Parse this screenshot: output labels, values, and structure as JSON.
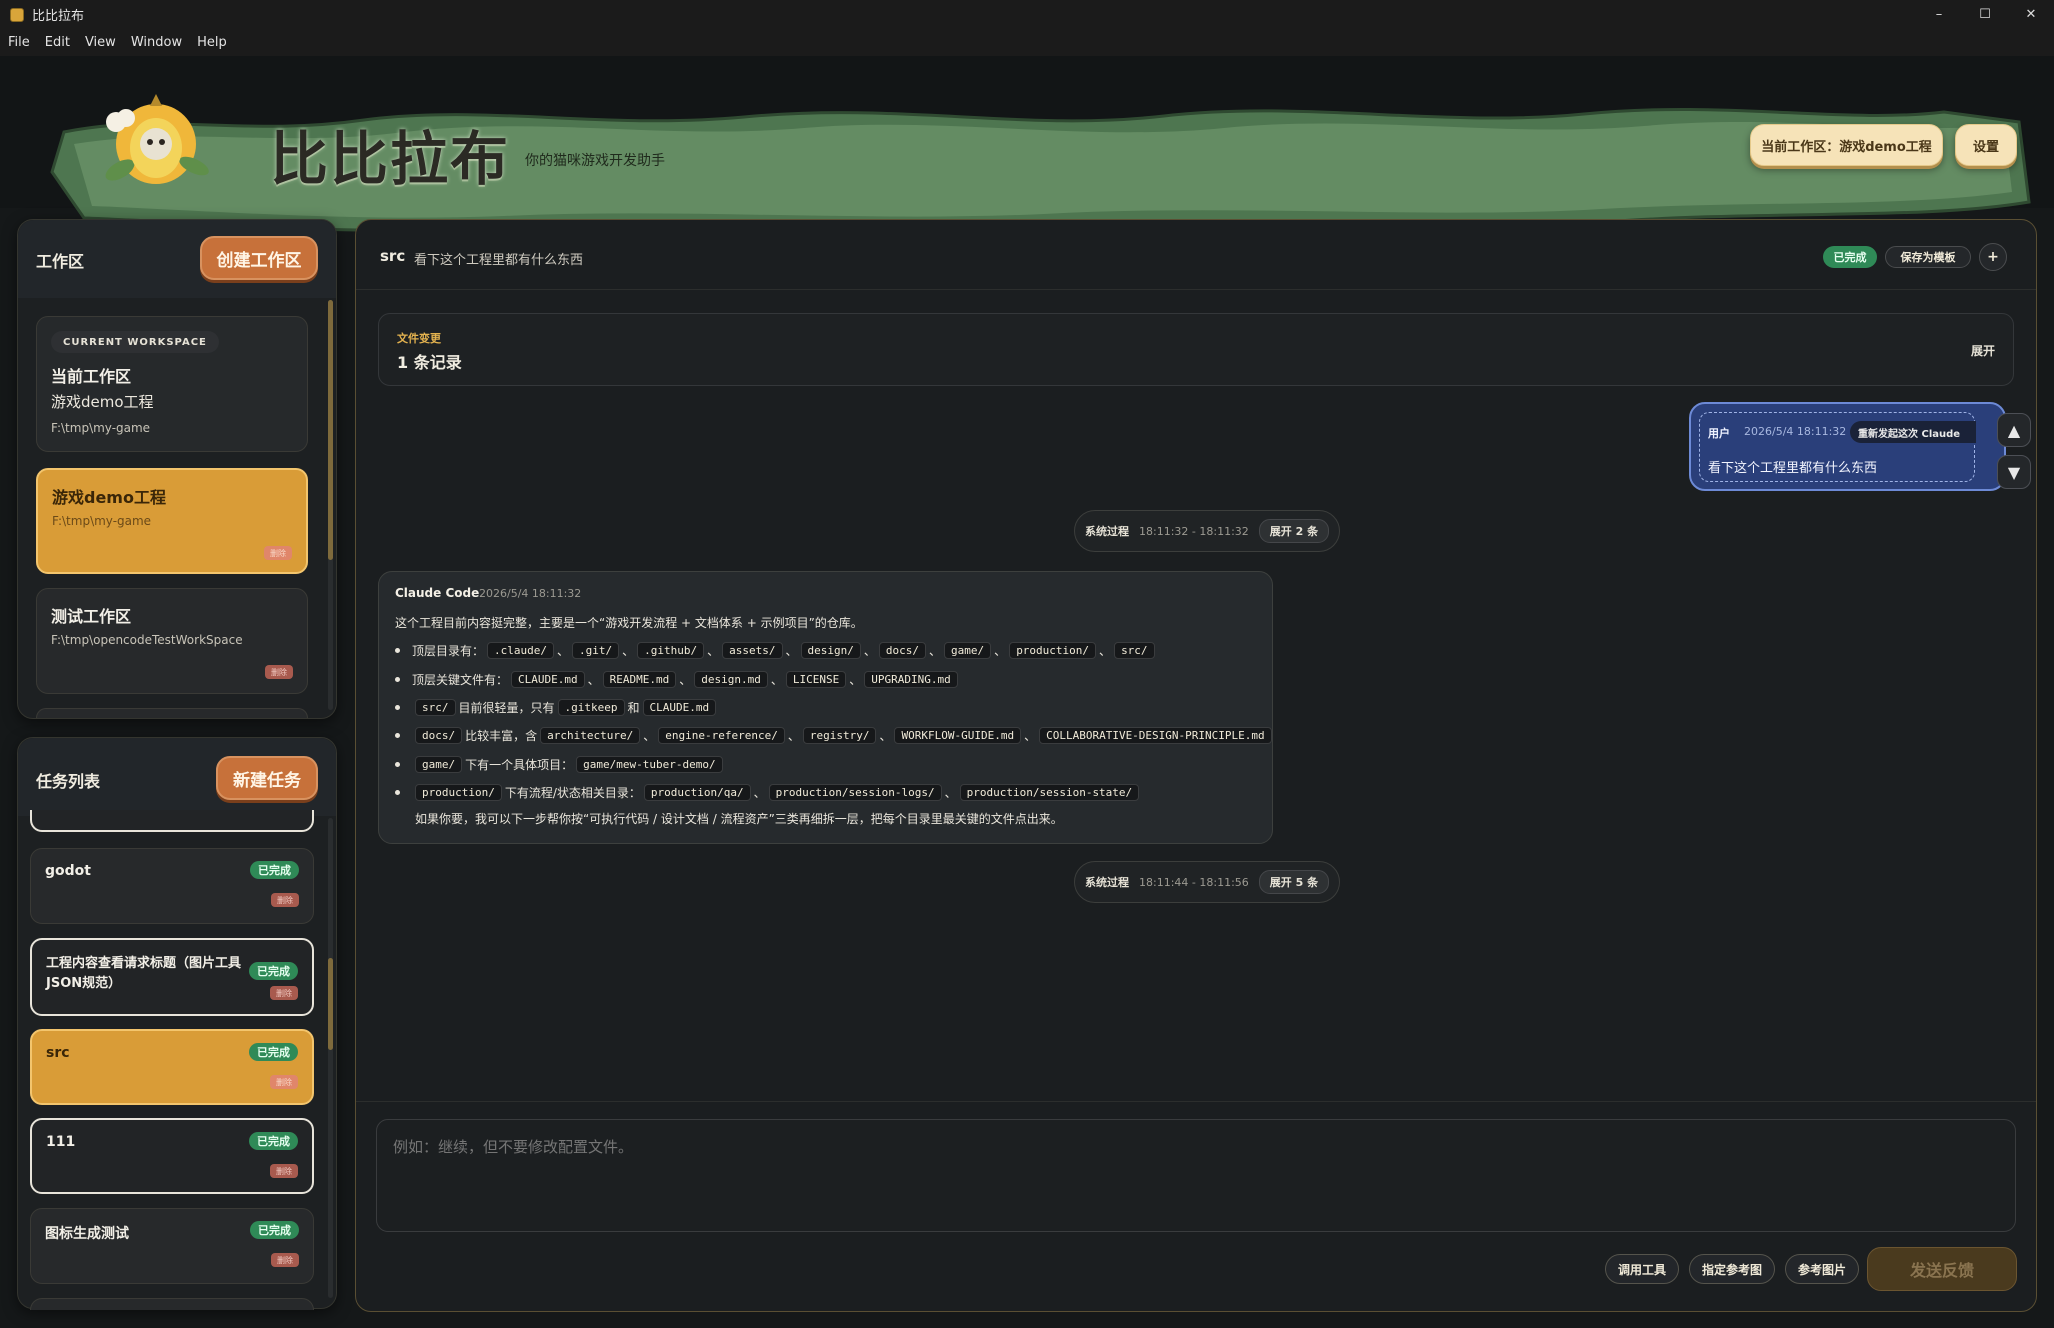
{
  "window": {
    "title": "比比拉布",
    "minimize": "–",
    "maximize": "☐",
    "close": "✕"
  },
  "menu": [
    "File",
    "Edit",
    "View",
    "Window",
    "Help"
  ],
  "header": {
    "brand": "比比拉布",
    "tagline": "你的猫咪游戏开发助手",
    "current_workspace_btn": "当前工作区：游戏demo工程",
    "settings_btn": "设置"
  },
  "workspace_panel": {
    "title": "工作区",
    "create_btn": "创建工作区",
    "current": {
      "badge": "CURRENT WORKSPACE",
      "heading": "当前工作区",
      "name": "游戏demo工程",
      "path": "F:\\tmp\\my-game"
    },
    "items": [
      {
        "name": "游戏demo工程",
        "path": "F:\\tmp\\my-game",
        "delete": "删除"
      },
      {
        "name": "测试工作区",
        "path": "F:\\tmp\\opencodeTestWorkSpace",
        "delete": "删除"
      }
    ]
  },
  "task_panel": {
    "title": "任务列表",
    "new_btn": "新建任务",
    "tasks": [
      {
        "name": "godot",
        "status": "已完成",
        "delete": "删除"
      },
      {
        "name": "工程内容查看请求标题（图片工具JSON规范）",
        "status": "已完成",
        "delete": "删除"
      },
      {
        "name": "src",
        "status": "已完成",
        "delete": "删除"
      },
      {
        "name": "111",
        "status": "已完成",
        "delete": "删除"
      },
      {
        "name": "图标生成测试",
        "status": "已完成",
        "delete": "删除"
      }
    ]
  },
  "conversation": {
    "task_name": "src",
    "task_desc": "看下这个工程里都有什么东西",
    "status": "已完成",
    "save_template": "保存为模板",
    "plus": "+",
    "file_changes": {
      "label": "文件变更",
      "count": "1 条记录",
      "expand": "展开"
    },
    "user_msg": {
      "role": "用户",
      "time": "2026/5/4 18:11:32",
      "resend": "重新发起这次 Claude",
      "text": "看下这个工程里都有什么东西"
    },
    "sys1": {
      "label": "系统过程",
      "time": "18:11:32 - 18:11:32",
      "expand": "展开 2 条"
    },
    "sys2": {
      "label": "系统过程",
      "time": "18:11:44 - 18:11:56",
      "expand": "展开 5 条"
    },
    "claude_msg": {
      "author": "Claude Code",
      "time": "2026/5/4 18:11:32",
      "intro": "这个工程目前内容挺完整，主要是一个“游戏开发流程 + 文档体系 + 示例项目”的仓库。",
      "b1_text": "顶层目录有：",
      "b1_codes": [
        ".claude/",
        ".git/",
        ".github/",
        "assets/",
        "design/",
        "docs/",
        "game/",
        "production/",
        "src/"
      ],
      "b2_text": "顶层关键文件有：",
      "b2_codes": [
        "CLAUDE.md",
        "README.md",
        "design.md",
        "LICENSE",
        "UPGRADING.md"
      ],
      "b3_code": "src/",
      "b3_mid": "目前很轻量，只有",
      "b3_code2": ".gitkeep",
      "b3_and": "和",
      "b3_code3": "CLAUDE.md",
      "b4_code": "docs/",
      "b4_mid": "比较丰富，含",
      "b4_codes": [
        "architecture/",
        "engine-reference/",
        "registry/",
        "WORKFLOW-GUIDE.md",
        "COLLABORATIVE-DESIGN-PRINCIPLE.md"
      ],
      "b5_code": "game/",
      "b5_mid": "下有一个具体项目：",
      "b5_code2": "game/mew-tuber-demo/",
      "b6_code": "production/",
      "b6_mid": "下有流程/状态相关目录：",
      "b6_codes": [
        "production/qa/",
        "production/session-logs/",
        "production/session-state/"
      ],
      "outro": "如果你要，我可以下一步帮你按“可执行代码 / 设计文档 / 流程资产”三类再细拆一层，把每个目录里最关键的文件点出来。"
    },
    "composer_placeholder": "例如：继续，但不要修改配置文件。",
    "tool_btn": "调用工具",
    "ref_btn": "指定参考图",
    "img_btn": "参考图片",
    "send_btn": "发送反馈",
    "arrow_up": "▲",
    "arrow_down": "▼"
  },
  "icons": [
    "app-icon",
    "cat-logo",
    "arrow-up-icon",
    "arrow-down-icon"
  ],
  "colors": {
    "accent_orange": "#c7713a",
    "active_card": "#d99c37",
    "done_green": "#2f8a57",
    "user_bubble": "#2a3f7a",
    "header_green": "#4f7a52"
  }
}
